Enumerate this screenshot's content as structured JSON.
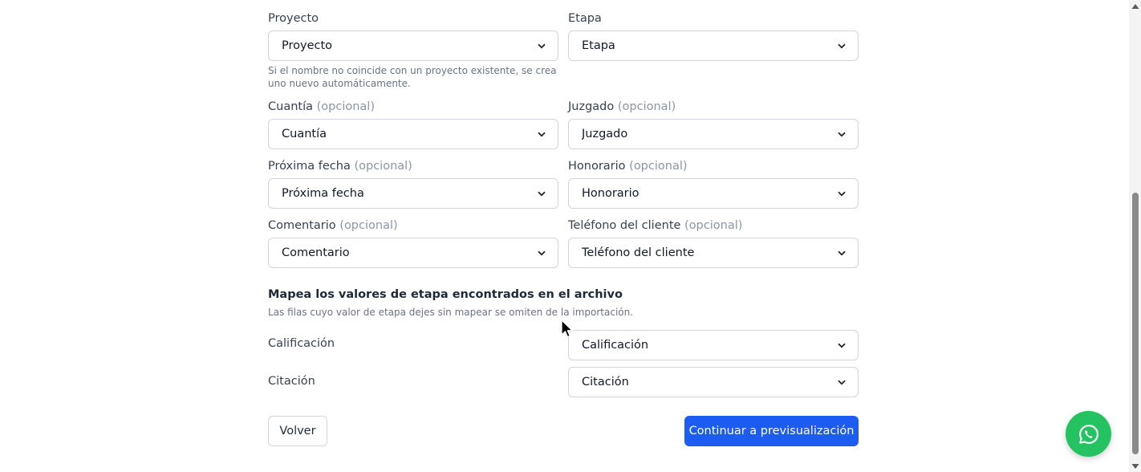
{
  "fields": {
    "proyecto": {
      "label": "Proyecto",
      "value": "Proyecto",
      "help": "Si el nombre no coincide con un proyecto existente, se crea uno nuevo automáticamente."
    },
    "etapa": {
      "label": "Etapa",
      "value": "Etapa"
    },
    "cuantia": {
      "label": "Cuantía",
      "optional": "(opcional)",
      "value": "Cuantía"
    },
    "juzgado": {
      "label": "Juzgado",
      "optional": "(opcional)",
      "value": "Juzgado"
    },
    "proxima_fecha": {
      "label": "Próxima fecha",
      "optional": "(opcional)",
      "value": "Próxima fecha"
    },
    "honorario": {
      "label": "Honorario",
      "optional": "(opcional)",
      "value": "Honorario"
    },
    "comentario": {
      "label": "Comentario",
      "optional": "(opcional)",
      "value": "Comentario"
    },
    "telefono": {
      "label": "Teléfono del cliente",
      "optional": "(opcional)",
      "value": "Teléfono del cliente"
    }
  },
  "stage_mapping": {
    "title": "Mapea los valores de etapa encontrados en el archivo",
    "subtitle": "Las filas cuyo valor de etapa dejes sin mapear se omiten de la importación.",
    "rows": [
      {
        "label": "Calificación",
        "value": "Calificación"
      },
      {
        "label": "Citación",
        "value": "Citación"
      }
    ]
  },
  "actions": {
    "back_label": "Volver",
    "continue_label": "Continuar a previsualización"
  },
  "icons": {
    "select_chevron": "chevron-down-icon",
    "whatsapp": "whatsapp-icon",
    "scroll_up": "scroll-up-arrow-icon",
    "scroll_down": "scroll-down-arrow-icon",
    "cursor": "mouse-pointer-icon"
  },
  "colors": {
    "primary": "#1d5cf0",
    "whatsapp": "#25c262",
    "border": "#d1d5db",
    "optional_text": "#8b95a3"
  }
}
